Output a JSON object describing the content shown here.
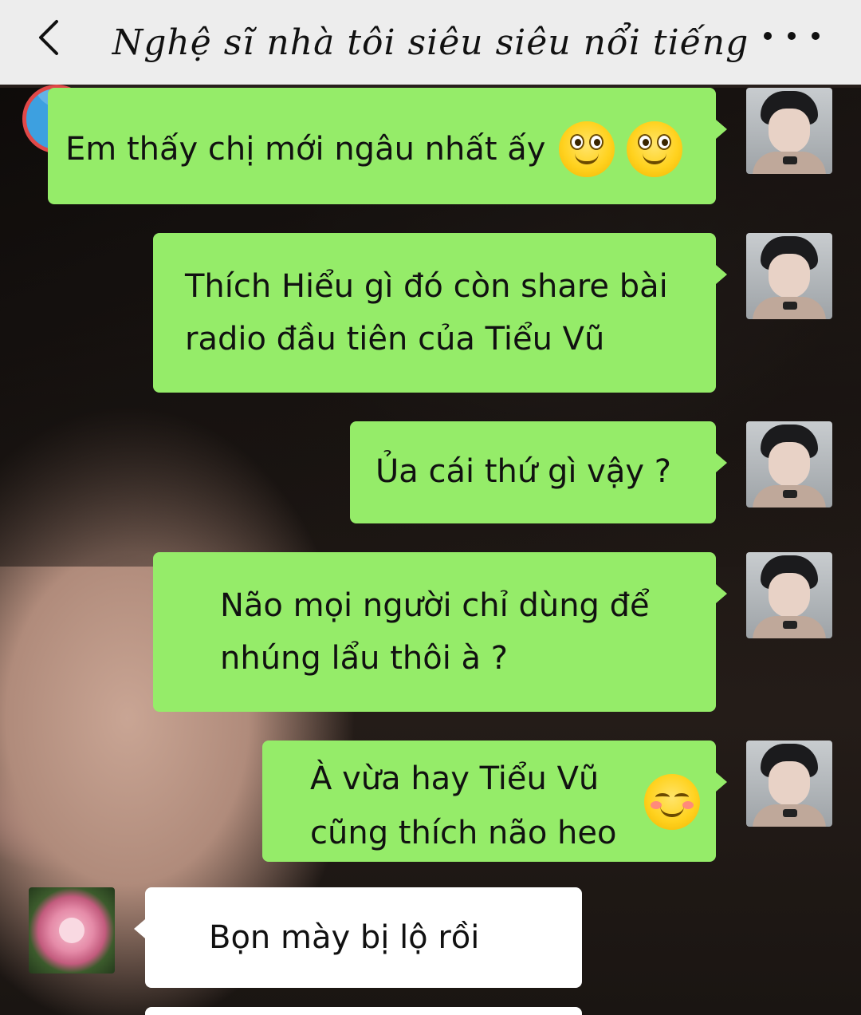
{
  "header": {
    "title": "Nghệ sĩ nhà tôi siêu siêu nổi tiếng"
  },
  "messages": [
    {
      "side": "right",
      "text": "Em thấy chị mới ngâu nhất ấy",
      "emoji": [
        "smile-wide-eyes",
        "smile-wide-eyes"
      ]
    },
    {
      "side": "right",
      "text": "Thích Hiểu gì đó còn share bài\nradio đầu tiên của Tiểu Vũ"
    },
    {
      "side": "right",
      "text": "Ủa cái thứ gì vậy ?"
    },
    {
      "side": "right",
      "text": "Não mọi người chỉ dùng để\nnhúng lẩu thôi à ?"
    },
    {
      "side": "right",
      "text": "À vừa hay Tiểu Vũ\ncũng thích não heo",
      "emoji": [
        "blush-smile"
      ]
    },
    {
      "side": "left",
      "text": "Bọn mày bị lộ rồi"
    }
  ],
  "colors": {
    "outgoing_bubble": "#95ec69",
    "incoming_bubble": "#ffffff",
    "header_bg": "#ededed"
  }
}
